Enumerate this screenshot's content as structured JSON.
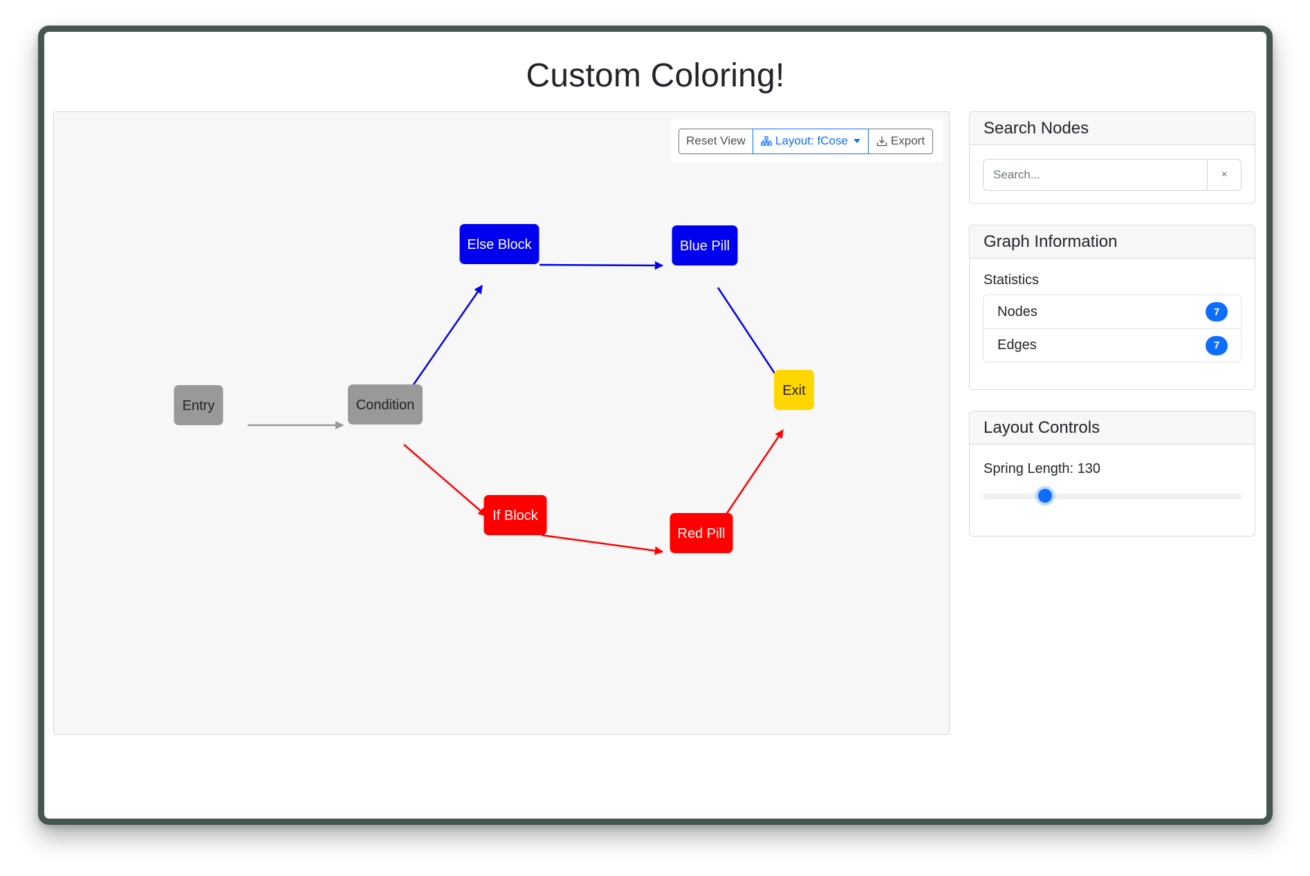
{
  "page": {
    "title": "Custom Coloring!"
  },
  "toolbar": {
    "reset_label": "Reset View",
    "layout_label": "Layout: fCose",
    "export_label": "Export"
  },
  "graph": {
    "nodes": [
      {
        "id": "entry",
        "label": "Entry",
        "fill": "#999999",
        "text_color": "#222222"
      },
      {
        "id": "condition",
        "label": "Condition",
        "fill": "#999999",
        "text_color": "#222222"
      },
      {
        "id": "else_block",
        "label": "Else Block",
        "fill": "#0000ee",
        "text_color": "#ffffff"
      },
      {
        "id": "blue_pill",
        "label": "Blue Pill",
        "fill": "#0000ee",
        "text_color": "#ffffff"
      },
      {
        "id": "exit",
        "label": "Exit",
        "fill": "#ffd600",
        "text_color": "#222222"
      },
      {
        "id": "if_block",
        "label": "If Block",
        "fill": "#ff0000",
        "text_color": "#ffffff"
      },
      {
        "id": "red_pill",
        "label": "Red Pill",
        "fill": "#ff0000",
        "text_color": "#ffffff"
      }
    ],
    "edges": [
      {
        "from": "entry",
        "to": "condition",
        "color": "#999999"
      },
      {
        "from": "condition",
        "to": "else_block",
        "color": "#0000ee"
      },
      {
        "from": "else_block",
        "to": "blue_pill",
        "color": "#0000ee"
      },
      {
        "from": "blue_pill",
        "to": "exit",
        "color": "#0000ee"
      },
      {
        "from": "condition",
        "to": "if_block",
        "color": "#ff0000"
      },
      {
        "from": "if_block",
        "to": "red_pill",
        "color": "#ff0000"
      },
      {
        "from": "red_pill",
        "to": "exit",
        "color": "#ff0000"
      }
    ]
  },
  "search": {
    "title": "Search Nodes",
    "placeholder": "Search...",
    "clear_label": "×"
  },
  "graph_info": {
    "title": "Graph Information",
    "statistics_label": "Statistics",
    "nodes_label": "Nodes",
    "nodes_count": "7",
    "edges_label": "Edges",
    "edges_count": "7"
  },
  "layout_controls": {
    "title": "Layout Controls",
    "spring_label": "Spring Length: 130",
    "spring_value": 130,
    "spring_fraction": 0.24
  },
  "colors": {
    "accent": "#0d6efd",
    "frame": "#44564d",
    "gray_node": "#999999",
    "blue_node": "#0000ee",
    "red_node": "#ff0000",
    "exit_node": "#ffd600"
  }
}
